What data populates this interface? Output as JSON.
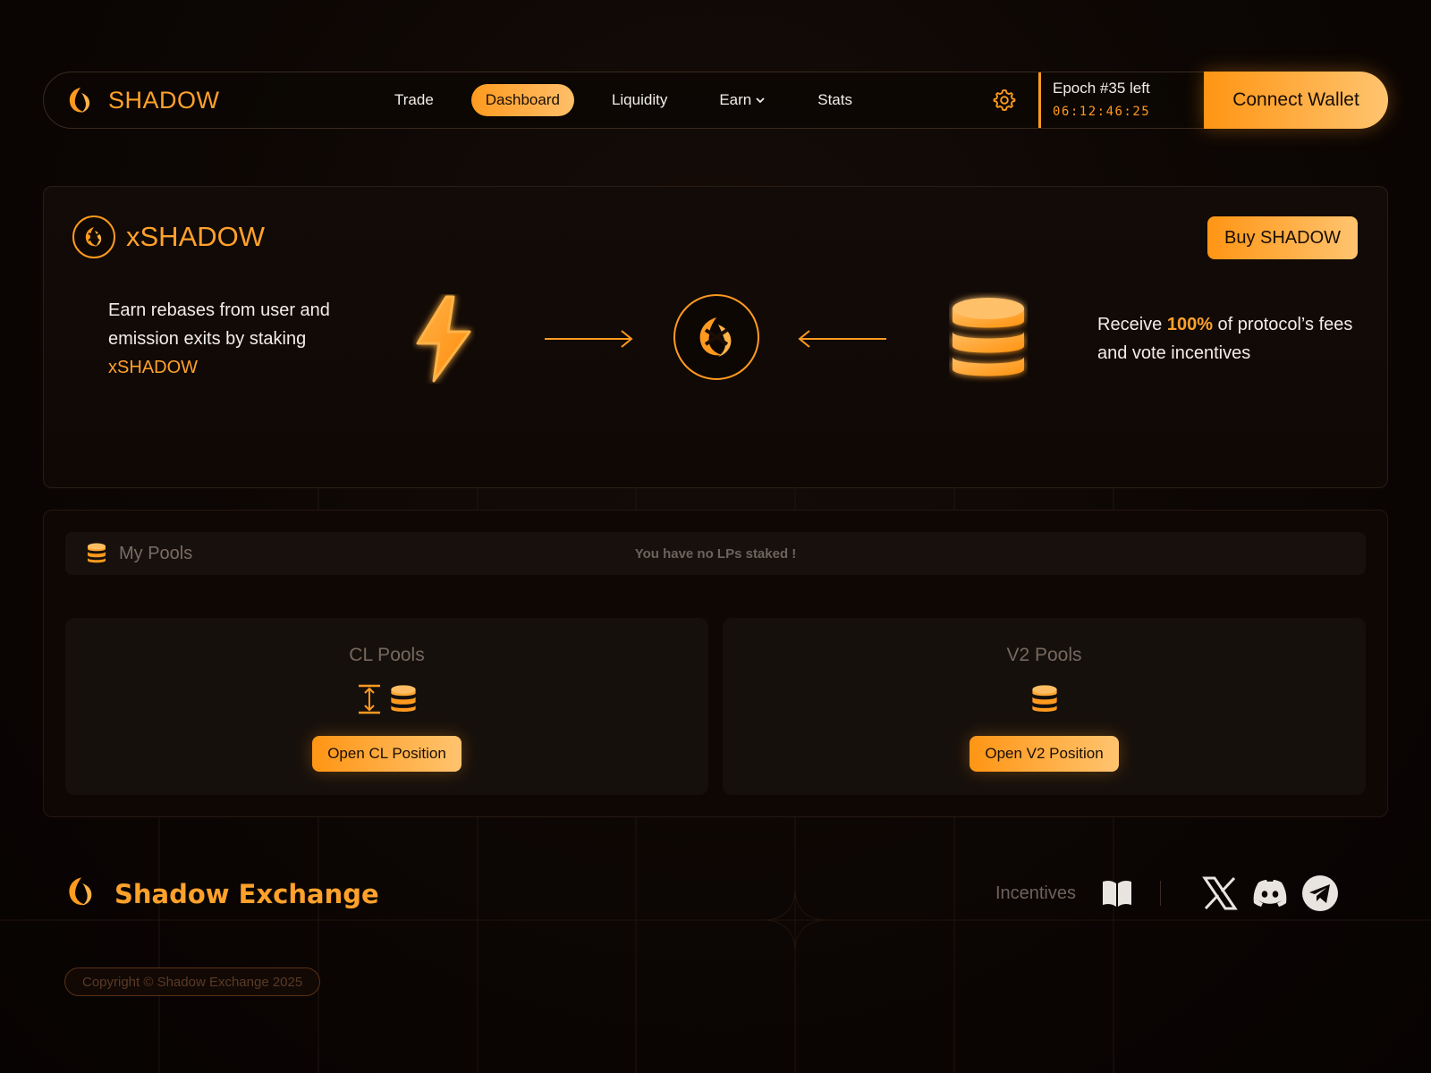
{
  "colors": {
    "accent": "#ff9a1f",
    "accent_light": "#ffc46f",
    "background": "#0c0604"
  },
  "nav": {
    "brand": "SHADOW",
    "links": [
      {
        "label": "Trade",
        "active": false
      },
      {
        "label": "Dashboard",
        "active": true
      },
      {
        "label": "Liquidity",
        "active": false
      },
      {
        "label": "Earn",
        "active": false,
        "dropdown": true
      },
      {
        "label": "Stats",
        "active": false
      }
    ],
    "settings_icon": "gear-icon",
    "epoch_label": "Epoch #35 left",
    "epoch_timer": "06:12:46:25",
    "connect_label": "Connect Wallet"
  },
  "hero": {
    "title": "xSHADOW",
    "buy_label": "Buy SHADOW",
    "left_text": "Earn rebases from user and emission exits by staking",
    "left_highlight": "xSHADOW",
    "right_prefix": "Receive",
    "right_highlight": "100%",
    "right_suffix": "of protocol’s fees and vote incentives",
    "icons": [
      "lightning-icon",
      "arrow-right-icon",
      "xshadow-coin-icon",
      "arrow-left-icon",
      "coin-stack-icon"
    ]
  },
  "pools": {
    "title": "My Pools",
    "empty_message": "You have no LPs staked !",
    "cards": [
      {
        "title": "CL Pools",
        "button": "Open CL Position",
        "icons": [
          "range-icon",
          "coin-stack-icon"
        ]
      },
      {
        "title": "V2 Pools",
        "button": "Open V2 Position",
        "icons": [
          "coin-stack-icon"
        ]
      }
    ]
  },
  "footer": {
    "brand": "Shadow Exchange",
    "incentives_label": "Incentives",
    "icons": [
      "book-icon",
      "x-icon",
      "discord-icon",
      "telegram-icon"
    ],
    "copyright": "Copyright © Shadow Exchange 2025"
  }
}
